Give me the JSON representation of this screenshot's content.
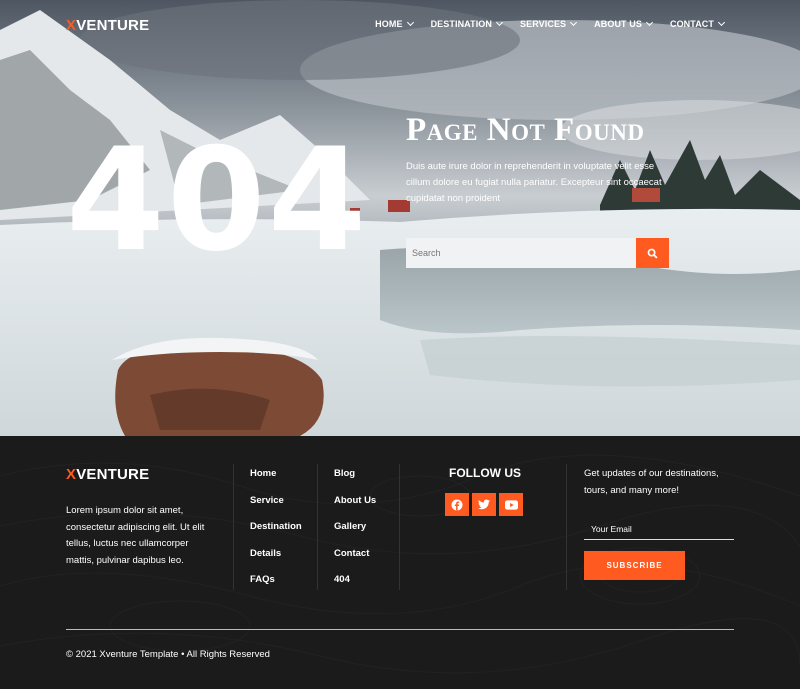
{
  "brand": {
    "logo_x": "X",
    "logo_rest": "VENTURE"
  },
  "nav": [
    {
      "label": "HOME"
    },
    {
      "label": "DESTINATION"
    },
    {
      "label": "SERVICES"
    },
    {
      "label": "ABOUT US"
    },
    {
      "label": "CONTACT"
    }
  ],
  "hero": {
    "code": "404",
    "title": "Page Not Found",
    "description": "Duis aute irure dolor in reprehenderit in voluptate velit esse cillum dolore eu fugiat nulla pariatur. Excepteur sint occaecat cupidatat non proident",
    "search_placeholder": "Search"
  },
  "footer": {
    "about": "Lorem ipsum dolor sit amet, consectetur adipiscing elit. Ut elit tellus, luctus nec ullamcorper mattis, pulvinar dapibus leo.",
    "links_col1": [
      "Home",
      "Service",
      "Destination",
      "Details",
      "FAQs"
    ],
    "links_col2": [
      "Blog",
      "About Us",
      "Gallery",
      "Contact",
      "404"
    ],
    "follow_title": "FOLLOW US",
    "socials": [
      "facebook-icon",
      "twitter-icon",
      "youtube-icon"
    ],
    "newsletter_text": "Get updates of our destinations, tours, and many more!",
    "email_placeholder": "Your Email",
    "subscribe_label": "SUBSCRIBE",
    "copyright": "© 2021 Xventure Template • All Rights Reserved"
  },
  "colors": {
    "accent": "#ff5a1f",
    "footer_bg": "#1b1b1b"
  }
}
